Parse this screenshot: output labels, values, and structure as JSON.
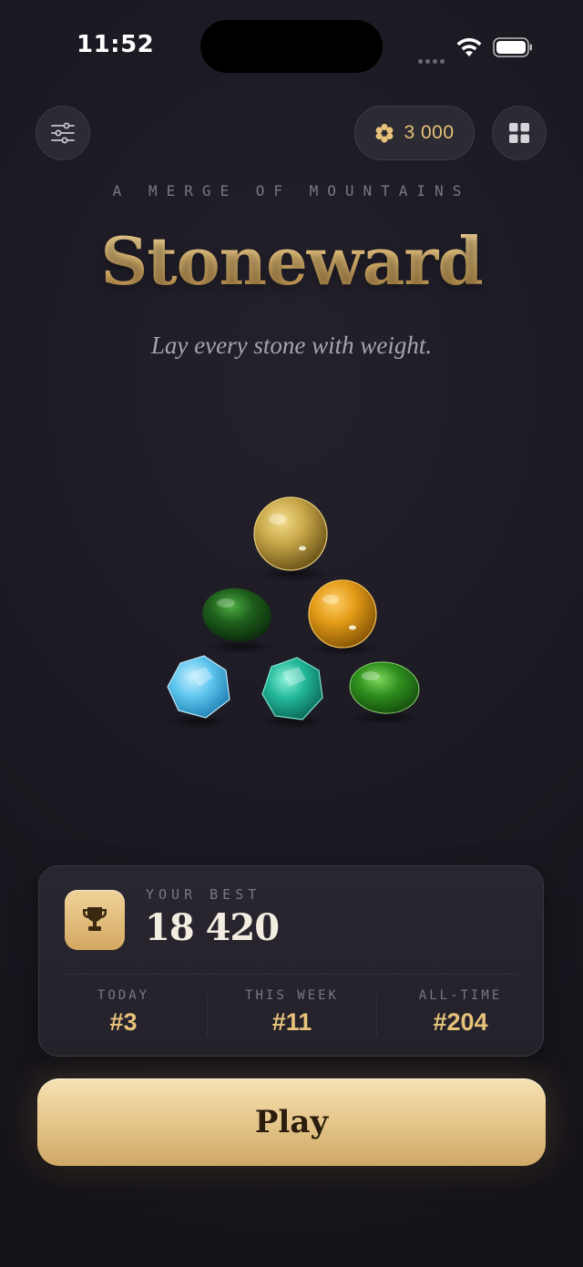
{
  "status_bar": {
    "time": "11:52"
  },
  "header": {
    "coins": "3 000",
    "settings_icon": "sliders-icon",
    "menu_icon": "grid-icon",
    "coin_icon": "honeycomb-icon"
  },
  "hero": {
    "kicker": "A MERGE OF MOUNTAINS",
    "title": "Stoneward",
    "subtitle": "Lay every stone with weight."
  },
  "stones": [
    {
      "name": "gold-orb",
      "color": "#c9a84a"
    },
    {
      "name": "dark-green-stone",
      "color": "#1f5f1c"
    },
    {
      "name": "amber-orb",
      "color": "#e39b17"
    },
    {
      "name": "sky-hexagon",
      "color": "#5fc6ef"
    },
    {
      "name": "teal-hexagon",
      "color": "#22b79a"
    },
    {
      "name": "green-stone",
      "color": "#2f8f1e"
    }
  ],
  "best_card": {
    "label": "YOUR BEST",
    "score": "18 420",
    "ranks": [
      {
        "label": "TODAY",
        "value": "#3"
      },
      {
        "label": "THIS WEEK",
        "value": "#11"
      },
      {
        "label": "ALL-TIME",
        "value": "#204"
      }
    ]
  },
  "play_button": {
    "label": "Play"
  },
  "colors": {
    "accent": "#e6c27a",
    "background": "#1a1820",
    "card": "#27242d"
  }
}
